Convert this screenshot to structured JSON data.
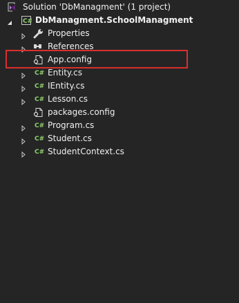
{
  "solution": {
    "label": "Solution 'DbManagment' (1 project)"
  },
  "project": {
    "label": "DbManagment.SchoolManagment"
  },
  "items": [
    {
      "label": "Properties",
      "icon": "wrench-icon"
    },
    {
      "label": "References",
      "icon": "references-icon"
    },
    {
      "label": "App.config",
      "icon": "config-file-icon"
    },
    {
      "label": "Entity.cs",
      "icon": "csharp-file-icon"
    },
    {
      "label": "IEntity.cs",
      "icon": "csharp-file-icon"
    },
    {
      "label": "Lesson.cs",
      "icon": "csharp-file-icon"
    },
    {
      "label": "packages.config",
      "icon": "config-file-icon"
    },
    {
      "label": "Program.cs",
      "icon": "csharp-file-icon"
    },
    {
      "label": "Student.cs",
      "icon": "csharp-file-icon"
    },
    {
      "label": "StudentContext.cs",
      "icon": "csharp-file-icon"
    }
  ],
  "icon_text": {
    "project": "C#",
    "csharp": "C#"
  },
  "colors": {
    "background": "#252526",
    "text": "#f1f1f1",
    "csharp_green": "#8ed26b",
    "highlight_border": "#d9302e",
    "solution_purple": "#a87fd7"
  }
}
